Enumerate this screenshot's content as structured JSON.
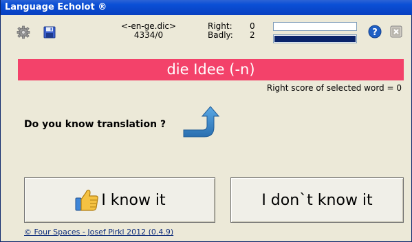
{
  "window": {
    "title": "Language Echolot ®"
  },
  "toolbar": {
    "settings_icon": "gear-icon",
    "save_icon": "floppy-disk-icon",
    "dictionary": "<-en-ge.dic>",
    "counter": "4334/0",
    "right_label": "Right:",
    "right_value": "0",
    "badly_label": "Badly:",
    "badly_value": "2",
    "right_progress": 0,
    "badly_progress": 1,
    "help_icon": "help-icon",
    "close_icon": "close-icon"
  },
  "word": {
    "text": "die Idee (-n)",
    "banner_color": "#f3426a",
    "right_score_text": "Right score of selected word = 0"
  },
  "prompt": {
    "question": "Do you know translation ?",
    "icon": "curved-arrow-up-icon"
  },
  "buttons": {
    "know_label": "I know it",
    "know_icon": "thumbs-up-icon",
    "dont_know_label": "I don`t know it"
  },
  "footer": {
    "credit": "© Four Spaces - Josef Pirkl 2012 (0.4.9)"
  }
}
